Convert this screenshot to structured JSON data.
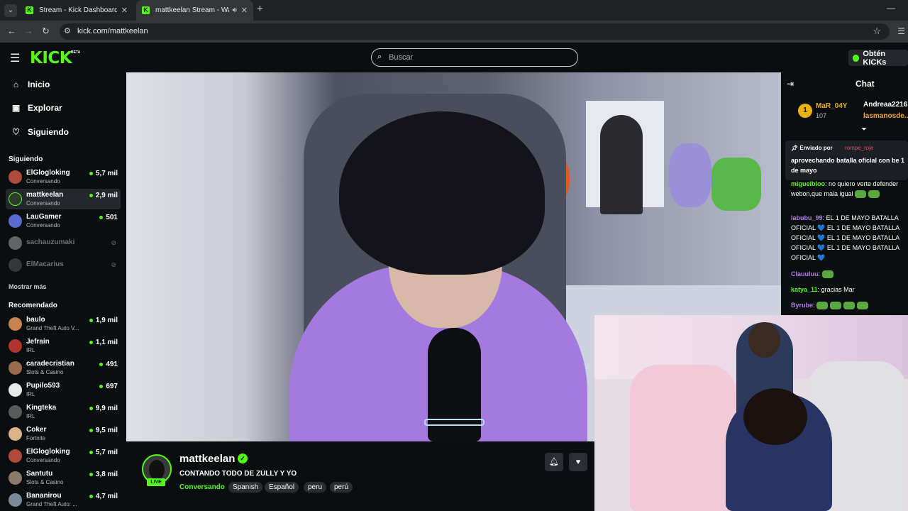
{
  "browser": {
    "tabs": [
      {
        "title": "Stream - Kick Dashboard"
      },
      {
        "title": "mattkeelan Stream - Watch"
      }
    ],
    "url": "kick.com/mattkeelan"
  },
  "header": {
    "logo": "KICK",
    "logo_badge": "BETA",
    "search_placeholder": "Buscar",
    "kicks_button": "Obtén KICKs"
  },
  "sidebar": {
    "nav": [
      {
        "label": "Inicio",
        "icon": "home-icon"
      },
      {
        "label": "Explorar",
        "icon": "browse-icon"
      },
      {
        "label": "Siguiendo",
        "icon": "heart-icon"
      }
    ],
    "following_title": "Siguiendo",
    "following": [
      {
        "name": "ElGlogloking",
        "category": "Conversando",
        "viewers": "5,7 mil",
        "color": "#b04a3a"
      },
      {
        "name": "mattkeelan",
        "category": "Conversando",
        "viewers": "2,9 mil",
        "color": "#2f3a2f"
      },
      {
        "name": "LauGamer",
        "category": "Conversando",
        "viewers": "501",
        "color": "#5a6bd0"
      },
      {
        "name": "sachauzumaki",
        "color": "#cfcfcf"
      },
      {
        "name": "ElMacarius",
        "color": "#6a6a6a"
      }
    ],
    "show_more": "Mostrar más",
    "recommended_title": "Recomendado",
    "recommended": [
      {
        "name": "baulo",
        "category": "Grand Theft Auto V...",
        "viewers": "1,9 mil",
        "color": "#c8844f"
      },
      {
        "name": "Jefrain",
        "category": "IRL",
        "viewers": "1,1 mil",
        "color": "#b0332c"
      },
      {
        "name": "caradecristian",
        "category": "Slots & Casino",
        "viewers": "491",
        "color": "#9a6a4a"
      },
      {
        "name": "Pupilo593",
        "category": "IRL",
        "viewers": "697",
        "color": "#e8e8e8"
      },
      {
        "name": "Kingteka",
        "category": "IRL",
        "viewers": "9,9 mil",
        "color": "#5a5a5a"
      },
      {
        "name": "Coker",
        "category": "Fortnite",
        "viewers": "9,5 mil",
        "color": "#d9b48a"
      },
      {
        "name": "ElGlogloking",
        "category": "Conversando",
        "viewers": "5,7 mil",
        "color": "#b04a3a"
      },
      {
        "name": "Santutu",
        "category": "Slots & Casino",
        "viewers": "3,8 mil",
        "color": "#8a7a6a"
      },
      {
        "name": "Bananirou",
        "category": "Grand Theft Auto: ...",
        "viewers": "4,7 mil",
        "color": "#7a8a9a"
      }
    ]
  },
  "stream": {
    "streamer": "mattkeelan",
    "live_label": "LIVE",
    "title": "CONTANDO TODO DE ZULLY Y YO",
    "category": "Conversando",
    "tags": [
      "Spanish",
      "Español",
      "peru",
      "perú"
    ]
  },
  "chat": {
    "title": "Chat",
    "top_gifter": {
      "rank": "1",
      "name": "MaR_04Y",
      "count": "107"
    },
    "gifter2": "Andreaa2216",
    "gifter3": "lasmanosde...",
    "pinned": {
      "label": "Enviado por",
      "user": "rompe_roje",
      "message": "aprovechando batalla oficial con be 1 de mayo"
    },
    "messages": [
      {
        "user": "miguelbloo",
        "color": "#53fc18",
        "text": "no quiero verte defender webon,que mala igual"
      },
      {
        "user": "labubu_99",
        "color": "#b47be8",
        "text": "EL 1 DE MAYO BATALLA OFICIAL 💙 EL 1 DE MAYO BATALLA OFICIAL 💙 EL 1 DE MAYO BATALLA OFICIAL 💙 EL 1 DE MAYO BATALLA OFICIAL 💙"
      },
      {
        "user": "Clauuluu",
        "color": "#b47be8",
        "text": ""
      },
      {
        "user": "katya_11",
        "color": "#53fc18",
        "text": "gracias Mar"
      },
      {
        "user": "Byrube",
        "color": "#b47be8",
        "text": ""
      }
    ]
  },
  "colors": {
    "brand": "#53fc18",
    "bg": "#0b0e0f"
  }
}
